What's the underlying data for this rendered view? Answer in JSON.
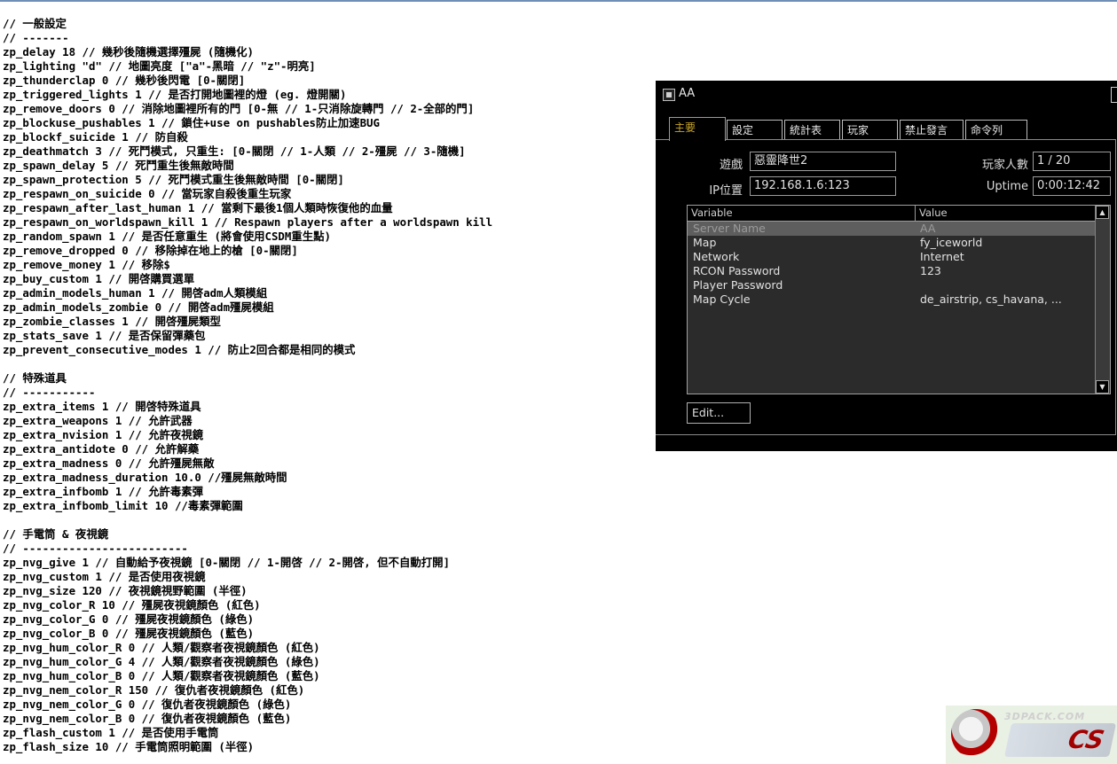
{
  "config_lines": [
    "// 一般設定",
    "// -------",
    "zp_delay 18 // 幾秒後隨機選擇殭屍 (隨機化)",
    "zp_lighting \"d\" // 地圖亮度 [\"a\"-黑暗 // \"z\"-明亮]",
    "zp_thunderclap 0 // 幾秒後閃電 [0-關閉]",
    "zp_triggered_lights 1 // 是否打開地圖裡的燈 (eg. 燈開關)",
    "zp_remove_doors 0 // 消除地圖裡所有的門 [0-無 // 1-只消除旋轉門 // 2-全部的門]",
    "zp_blockuse_pushables 1 // 鎖住+use on pushables防止加速BUG",
    "zp_blockf_suicide 1 // 防自殺",
    "zp_deathmatch 3 // 死鬥模式, 只重生: [0-關閉 // 1-人類 // 2-殭屍 // 3-隨機]",
    "zp_spawn_delay 5 // 死鬥重生後無敵時間",
    "zp_spawn_protection 5 // 死鬥模式重生後無敵時間 [0-關閉]",
    "zp_respawn_on_suicide 0 // 當玩家自殺後重生玩家",
    "zp_respawn_after_last_human 1 // 當剩下最後1個人類時恢復他的血量",
    "zp_respawn_on_worldspawn_kill 1 // Respawn players after a worldspawn kill",
    "zp_random_spawn 1 // 是否任意重生 (將會使用CSDM重生點)",
    "zp_remove_dropped 0 // 移除掉在地上的槍 [0-關閉]",
    "zp_remove_money 1 // 移除$",
    "zp_buy_custom 1 // 開啓購買選單",
    "zp_admin_models_human 1 // 開啓adm人類模組",
    "zp_admin_models_zombie 0 // 開啓adm殭屍模組",
    "zp_zombie_classes 1 // 開啓殭屍類型",
    "zp_stats_save 1 // 是否保留彈藥包",
    "zp_prevent_consecutive_modes 1 // 防止2回合都是相同的模式",
    "",
    "// 特殊道具",
    "// -----------",
    "zp_extra_items 1 // 開啓特殊道具",
    "zp_extra_weapons 1 // 允許武器",
    "zp_extra_nvision 1 // 允許夜視鏡",
    "zp_extra_antidote 0 // 允許解藥",
    "zp_extra_madness 0 // 允許殭屍無敵",
    "zp_extra_madness_duration 10.0 //殭屍無敵時間",
    "zp_extra_infbomb 1 // 允許毒素彈",
    "zp_extra_infbomb_limit 10 //毒素彈範圍",
    "",
    "// 手電筒 & 夜視鏡",
    "// -------------------------",
    "zp_nvg_give 1 // 自動給予夜視鏡 [0-關閉 // 1-開啓 // 2-開啓, 但不自動打開]",
    "zp_nvg_custom 1 // 是否使用夜視鏡",
    "zp_nvg_size 120 // 夜視鏡視野範圍 (半徑)",
    "zp_nvg_color_R 10 // 殭屍夜視鏡顏色 (紅色)",
    "zp_nvg_color_G 0 // 殭屍夜視鏡顏色 (綠色)",
    "zp_nvg_color_B 0 // 殭屍夜視鏡顏色 (藍色)",
    "zp_nvg_hum_color_R 0 // 人類/觀察者夜視鏡顏色 (紅色)",
    "zp_nvg_hum_color_G 4 // 人類/觀察者夜視鏡顏色 (綠色)",
    "zp_nvg_hum_color_B 0 // 人類/觀察者夜視鏡顏色 (藍色)",
    "zp_nvg_nem_color_R 150 // 復仇者夜視鏡顏色 (紅色)",
    "zp_nvg_nem_color_G 0 // 復仇者夜視鏡顏色 (綠色)",
    "zp_nvg_nem_color_B 0 // 復仇者夜視鏡顏色 (藍色)",
    "zp_flash_custom 1 // 是否使用手電筒",
    "zp_flash_size 10 // 手電筒照明範圍 (半徑)"
  ],
  "server_window": {
    "title": "AA",
    "tabs": [
      {
        "label": "主要",
        "active": true
      },
      {
        "label": "設定",
        "active": false
      },
      {
        "label": "統計表",
        "active": false
      },
      {
        "label": "玩家",
        "active": false
      },
      {
        "label": "禁止發言",
        "active": false
      },
      {
        "label": "命令列",
        "active": false
      }
    ],
    "game_label": "遊戲",
    "game_value": "惡靈降世2",
    "ip_label": "IP位置",
    "ip_value": "192.168.1.6:123",
    "players_label": "玩家人數",
    "players_value": "1 / 20",
    "uptime_label": "Uptime",
    "uptime_value": "0:00:12:42",
    "list_headers": {
      "variable": "Variable",
      "value": "Value"
    },
    "rows": [
      {
        "variable": "Server Name",
        "value": "AA",
        "selected": true
      },
      {
        "variable": "Map",
        "value": "fy_iceworld",
        "selected": false
      },
      {
        "variable": "Network",
        "value": "Internet",
        "selected": false
      },
      {
        "variable": "RCON Password",
        "value": "123",
        "selected": false
      },
      {
        "variable": "Player Password",
        "value": "",
        "selected": false
      },
      {
        "variable": "Map Cycle",
        "value": "de_airstrip, cs_havana, ...",
        "selected": false
      }
    ],
    "edit_label": "Edit..."
  },
  "watermark": {
    "text": "3DPACK.COM",
    "brand": "CS"
  },
  "colors": {
    "window_bg": "#000000",
    "active_tab_text": "#c8a428",
    "list_bg": "#2b2b2b",
    "selected_row_bg": "#5e5e5e"
  }
}
